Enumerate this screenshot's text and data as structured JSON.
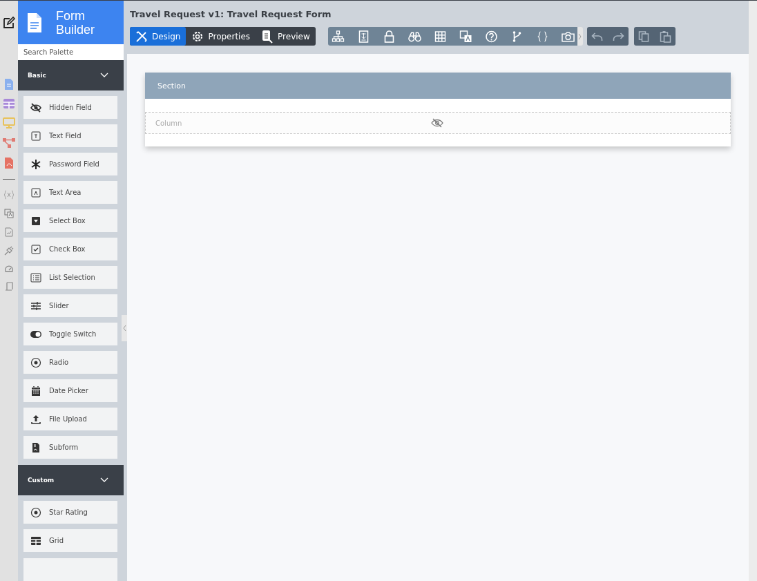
{
  "app": {
    "title": "Form Builder"
  },
  "header": {
    "title": "Travel Request v1: Travel Request Form"
  },
  "tabs": [
    {
      "label": "Design",
      "selected": true
    },
    {
      "label": "Properties",
      "selected": false
    },
    {
      "label": "Preview",
      "selected": false
    }
  ],
  "palette": {
    "search": {
      "placeholder": "Search Palette"
    },
    "groups": [
      {
        "label": "Basic",
        "expanded": true,
        "items": [
          "Hidden Field",
          "Text Field",
          "Password Field",
          "Text Area",
          "Select Box",
          "Check Box",
          "List Selection",
          "Slider",
          "Toggle Switch",
          "Radio",
          "Date Picker",
          "File Upload",
          "Subform"
        ]
      },
      {
        "label": "Custom",
        "expanded": true,
        "items": [
          "Star Rating",
          "Grid"
        ]
      }
    ]
  },
  "canvas": {
    "section": {
      "title": "Section",
      "column": {
        "label": "Column"
      }
    }
  }
}
